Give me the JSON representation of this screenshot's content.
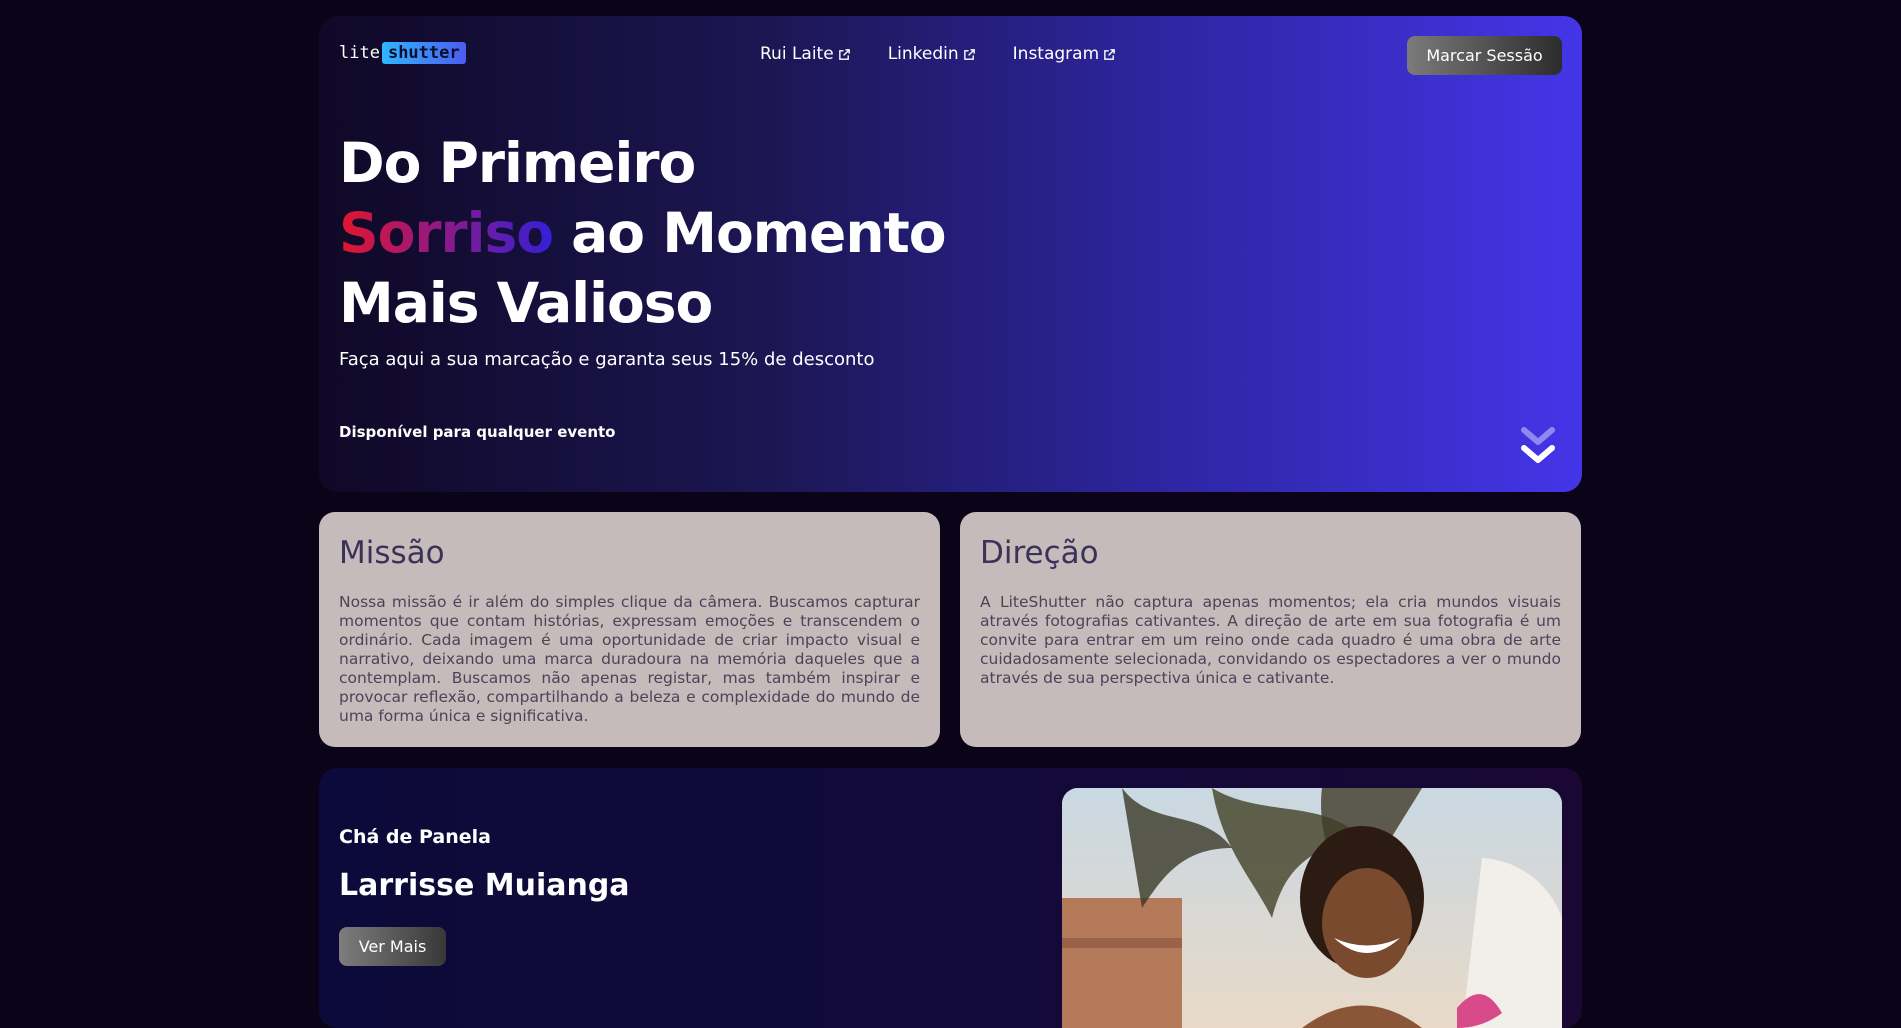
{
  "logo": {
    "part1": "lite",
    "part2": "shutter"
  },
  "nav": {
    "links": [
      {
        "label": "Rui Laite",
        "icon": "external-link-icon"
      },
      {
        "label": "Linkedin",
        "icon": "external-link-icon"
      },
      {
        "label": "Instagram",
        "icon": "external-link-icon"
      }
    ],
    "cta_label": "Marcar Sessão"
  },
  "hero": {
    "line1": "Do Primeiro",
    "line2_highlight": "Sorriso",
    "line2_rest": " ao Momento",
    "line3": "Mais Valioso",
    "subtitle": "Faça aqui a sua marcação e garanta seus 15% de desconto",
    "availability": "Disponível para qualquer evento",
    "scroll_icon": "double-chevron-down-icon"
  },
  "cards": [
    {
      "title": "Missão",
      "text": "Nossa missão é ir além do simples clique da câmera. Buscamos capturar momentos que contam histórias, expressam emoções e transcendem o ordinário. Cada imagem é uma oportunidade de criar impacto visual e narrativo, deixando uma marca duradoura na memória daqueles que a contemplam. Buscamos não apenas registar, mas também inspirar e provocar reflexão, compartilhando a beleza e complexidade do mundo de uma forma única e significativa."
    },
    {
      "title": "Direção",
      "text": "A LiteShutter não captura apenas momentos; ela cria mundos visuais através fotografias cativantes. A direção de arte em sua fotografia é um convite para entrar em um reino onde cada quadro é uma obra de arte cuidadosamente selecionada, convidando os espectadores a ver o mundo através de sua perspectiva única e cativante."
    }
  ],
  "feature": {
    "event": "Chá de Panela",
    "name": "Larrisse Muianga",
    "button": "Ver Mais"
  },
  "colors": {
    "background": "#0b0318",
    "hero_start": "#0f0826",
    "hero_end": "#4435e8",
    "card_bg": "#c6bbbb",
    "highlight_start": "#e3152e",
    "highlight_end": "#3320d8"
  }
}
